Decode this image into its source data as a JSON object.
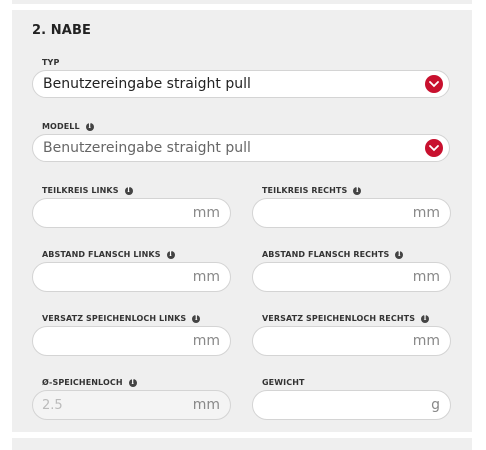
{
  "section": {
    "title": "2. NABE"
  },
  "typ": {
    "label": "TYP",
    "value": "Benutzereingabe straight pull"
  },
  "modell": {
    "label": "MODELL",
    "value": "Benutzereingabe straight pull"
  },
  "fields": [
    {
      "label": "TEILKREIS LINKS",
      "unit": "mm",
      "value": ""
    },
    {
      "label": "TEILKREIS RECHTS",
      "unit": "mm",
      "value": ""
    },
    {
      "label": "ABSTAND FLANSCH LINKS",
      "unit": "mm",
      "value": ""
    },
    {
      "label": "ABSTAND FLANSCH RECHTS",
      "unit": "mm",
      "value": ""
    },
    {
      "label": "VERSATZ SPEICHENLOCH LINKS",
      "unit": "mm",
      "value": ""
    },
    {
      "label": "VERSATZ SPEICHENLOCH RECHTS",
      "unit": "mm",
      "value": ""
    },
    {
      "label": "Ø-SPEICHENLOCH",
      "unit": "mm",
      "value": "2.5"
    },
    {
      "label": "GEWICHT",
      "unit": "g",
      "value": ""
    }
  ],
  "info_symbol": "i",
  "colors": {
    "accent": "#c8102e",
    "panel": "#efefef"
  }
}
